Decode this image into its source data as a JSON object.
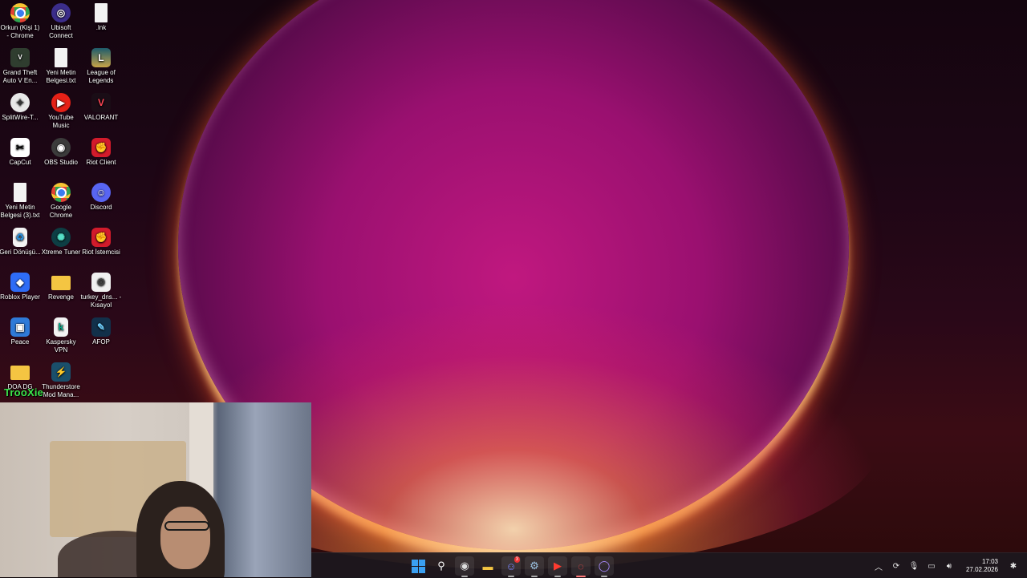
{
  "desktop": {
    "icons": [
      {
        "label": "Orkun (Kişi 1) - Chrome",
        "icon": "chrome-icon"
      },
      {
        "label": "Ubisoft Connect",
        "icon": "ubisoft-icon"
      },
      {
        "label": ".lnk",
        "icon": "file-icon"
      },
      {
        "label": "Grand Theft Auto V En...",
        "icon": "gta-icon"
      },
      {
        "label": "Yeni Metin Belgesi.txt",
        "icon": "text-file-icon"
      },
      {
        "label": "League of Legends",
        "icon": "league-icon"
      },
      {
        "label": "SplitWire-T...",
        "icon": "splitwire-icon"
      },
      {
        "label": "YouTube Music",
        "icon": "youtube-music-icon"
      },
      {
        "label": "VALORANT",
        "icon": "valorant-icon"
      },
      {
        "label": "CapCut",
        "icon": "capcut-icon"
      },
      {
        "label": "OBS Studio",
        "icon": "obs-icon"
      },
      {
        "label": "Riot Client",
        "icon": "riot-icon"
      },
      {
        "label": "Yeni Metin Belgesi (3).txt",
        "icon": "text-file-icon"
      },
      {
        "label": "Google Chrome",
        "icon": "chrome-icon"
      },
      {
        "label": "Discord",
        "icon": "discord-icon"
      },
      {
        "label": "Geri Dönüşü...",
        "icon": "recycle-bin-icon"
      },
      {
        "label": "Xtreme Tuner",
        "icon": "xtreme-tuner-icon"
      },
      {
        "label": "Riot İstemcisi",
        "icon": "riot-icon"
      },
      {
        "label": "Roblox Player",
        "icon": "roblox-icon"
      },
      {
        "label": "Revenge",
        "icon": "folder-icon"
      },
      {
        "label": "turkey_dns... - Kısayol",
        "icon": "shortcut-icon"
      },
      {
        "label": "Peace",
        "icon": "peace-icon"
      },
      {
        "label": "Kaspersky VPN",
        "icon": "kaspersky-icon"
      },
      {
        "label": "AFOP",
        "icon": "afop-icon"
      },
      {
        "label": "DOA DG",
        "icon": "folder-icon"
      },
      {
        "label": "Thunderstore Mod Mana...",
        "icon": "thunderstore-icon"
      }
    ]
  },
  "overlay": {
    "brand": "TrooXie"
  },
  "taskbar": {
    "apps": [
      {
        "name": "start-button",
        "icon": "windows-icon"
      },
      {
        "name": "search-button",
        "icon": "search-icon"
      },
      {
        "name": "obs-taskbar-button",
        "icon": "obs-icon"
      },
      {
        "name": "file-explorer-button",
        "icon": "folder-icon"
      },
      {
        "name": "discord-taskbar-button",
        "icon": "discord-icon",
        "badge": "3"
      },
      {
        "name": "steam-taskbar-button",
        "icon": "steam-icon"
      },
      {
        "name": "youtube-music-taskbar-button",
        "icon": "youtube-music-icon"
      },
      {
        "name": "riot-taskbar-button",
        "icon": "riot-icon"
      },
      {
        "name": "app-taskbar-button",
        "icon": "circle-app-icon"
      }
    ],
    "clock": {
      "time": "17:03",
      "date": "27.02.2026"
    },
    "colors": {
      "windows_blue": "#3aa0f2",
      "discord": "#5865f2",
      "riot_red": "#d21b2b",
      "brand_green": "#3be34a"
    }
  }
}
